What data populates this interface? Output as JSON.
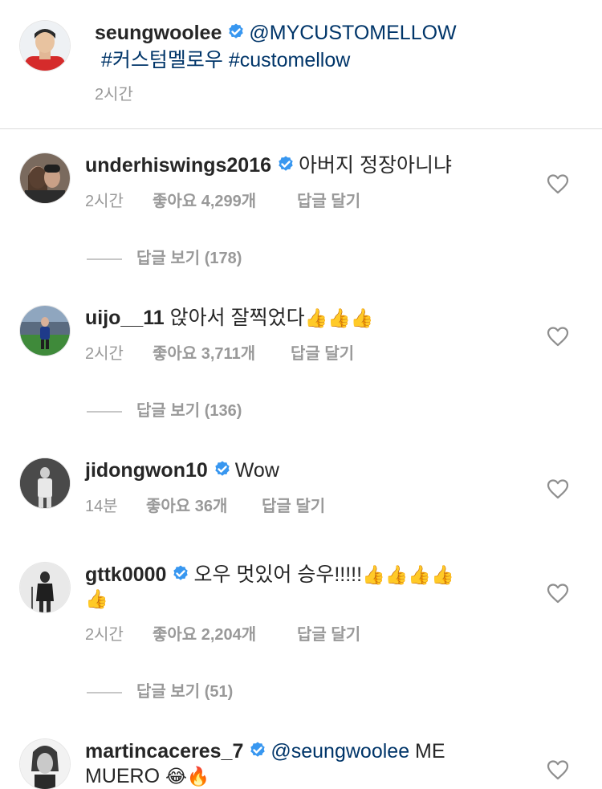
{
  "caption": {
    "username": "seungwoolee",
    "mention": "@MYCUSTOMELLOW",
    "hashtags": "#커스텀멜로우 #customellow",
    "time": "2시간"
  },
  "comments": [
    {
      "username": "underhiswings2016",
      "verified": true,
      "text": "아버지 정장아니냐",
      "time": "2시간",
      "likes": "좋아요 4,299개",
      "reply": "답글 달기",
      "view_replies": "답글 보기 (178)"
    },
    {
      "username": "uijo__11",
      "verified": false,
      "text": "앉아서 잘찍었다",
      "emoji": "👍👍👍",
      "time": "2시간",
      "likes": "좋아요 3,711개",
      "reply": "답글 달기",
      "view_replies": "답글 보기 (136)"
    },
    {
      "username": "jidongwon10",
      "verified": true,
      "text": "Wow",
      "time": "14분",
      "likes": "좋아요 36개",
      "reply": "답글 달기"
    },
    {
      "username": "gttk0000",
      "verified": true,
      "text": "오우 멋있어 승우!!!!!",
      "emoji": "👍👍👍👍",
      "emoji2": "👍",
      "time": "2시간",
      "likes": "좋아요 2,204개",
      "reply": "답글 달기",
      "view_replies": "답글 보기 (51)"
    },
    {
      "username": "martincaceres_7",
      "verified": true,
      "mention": "@seungwoolee",
      "text": "ME",
      "text2": "MUERO",
      "emoji": "😂🔥"
    }
  ],
  "icons": {
    "verified": "verified-badge-icon",
    "heart": "heart-outline-icon"
  },
  "colors": {
    "verified_blue": "#3897f0",
    "link": "#003569",
    "meta_gray": "#999999"
  }
}
